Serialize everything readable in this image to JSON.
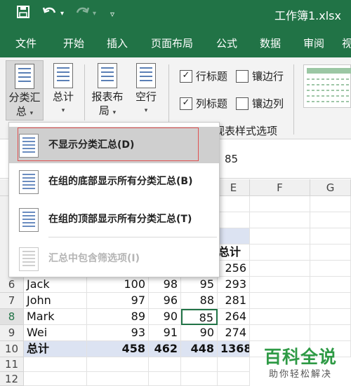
{
  "window": {
    "title": "工作簿1.xlsx"
  },
  "qat": {
    "save_icon": "save-icon",
    "undo_icon": "undo-icon",
    "redo_icon": "redo-icon",
    "customize_icon": "customize-qat-icon"
  },
  "tabs": [
    {
      "label": "文件"
    },
    {
      "label": "开始"
    },
    {
      "label": "插入"
    },
    {
      "label": "页面布局"
    },
    {
      "label": "公式"
    },
    {
      "label": "数据"
    },
    {
      "label": "审阅"
    },
    {
      "label": "视"
    }
  ],
  "ribbon": {
    "subtotal_line1": "分类汇",
    "subtotal_line2": "总",
    "grandtotal": "总计",
    "report_layout_line1": "报表布",
    "report_layout_line2": "局",
    "blank_rows": "空行",
    "row_headers": "行标题",
    "banded_rows": "镶边行",
    "col_headers": "列标题",
    "banded_cols": "镶边列",
    "style_options_group": "视表样式选项"
  },
  "formula_bar": {
    "value": "85"
  },
  "columns": [
    "E",
    "F",
    "G"
  ],
  "rows": [
    "6",
    "7",
    "8",
    "9",
    "10",
    "11",
    "12"
  ],
  "grid": {
    "header_label": "总计",
    "top_value": "256",
    "data": [
      {
        "name": "Jack",
        "v1": "100",
        "v2": "98",
        "v3": "95",
        "total": "293"
      },
      {
        "name": "John",
        "v1": "97",
        "v2": "96",
        "v3": "88",
        "total": "281"
      },
      {
        "name": "Mark",
        "v1": "89",
        "v2": "90",
        "v3": "85",
        "total": "264"
      },
      {
        "name": "Wei",
        "v1": "93",
        "v2": "91",
        "v3": "90",
        "total": "274"
      }
    ],
    "grand_total": {
      "name": "总计",
      "v1": "458",
      "v2": "462",
      "v3": "448",
      "total": "1368"
    }
  },
  "dropdown": {
    "items": [
      {
        "label": "不显示分类汇总(D)"
      },
      {
        "label": "在组的底部显示所有分类汇总(B)"
      },
      {
        "label": "在组的顶部显示所有分类汇总(T)"
      },
      {
        "label": "汇总中包含筛选项(I)"
      }
    ]
  },
  "watermark": {
    "title": "百科全说",
    "subtitle": "助你轻松解决"
  },
  "colors": {
    "excel_green": "#217346",
    "ribbon_bg": "#f3f3f3",
    "total_band": "#dce3f2",
    "selection": "#217346",
    "highlight_border": "#e05050"
  }
}
